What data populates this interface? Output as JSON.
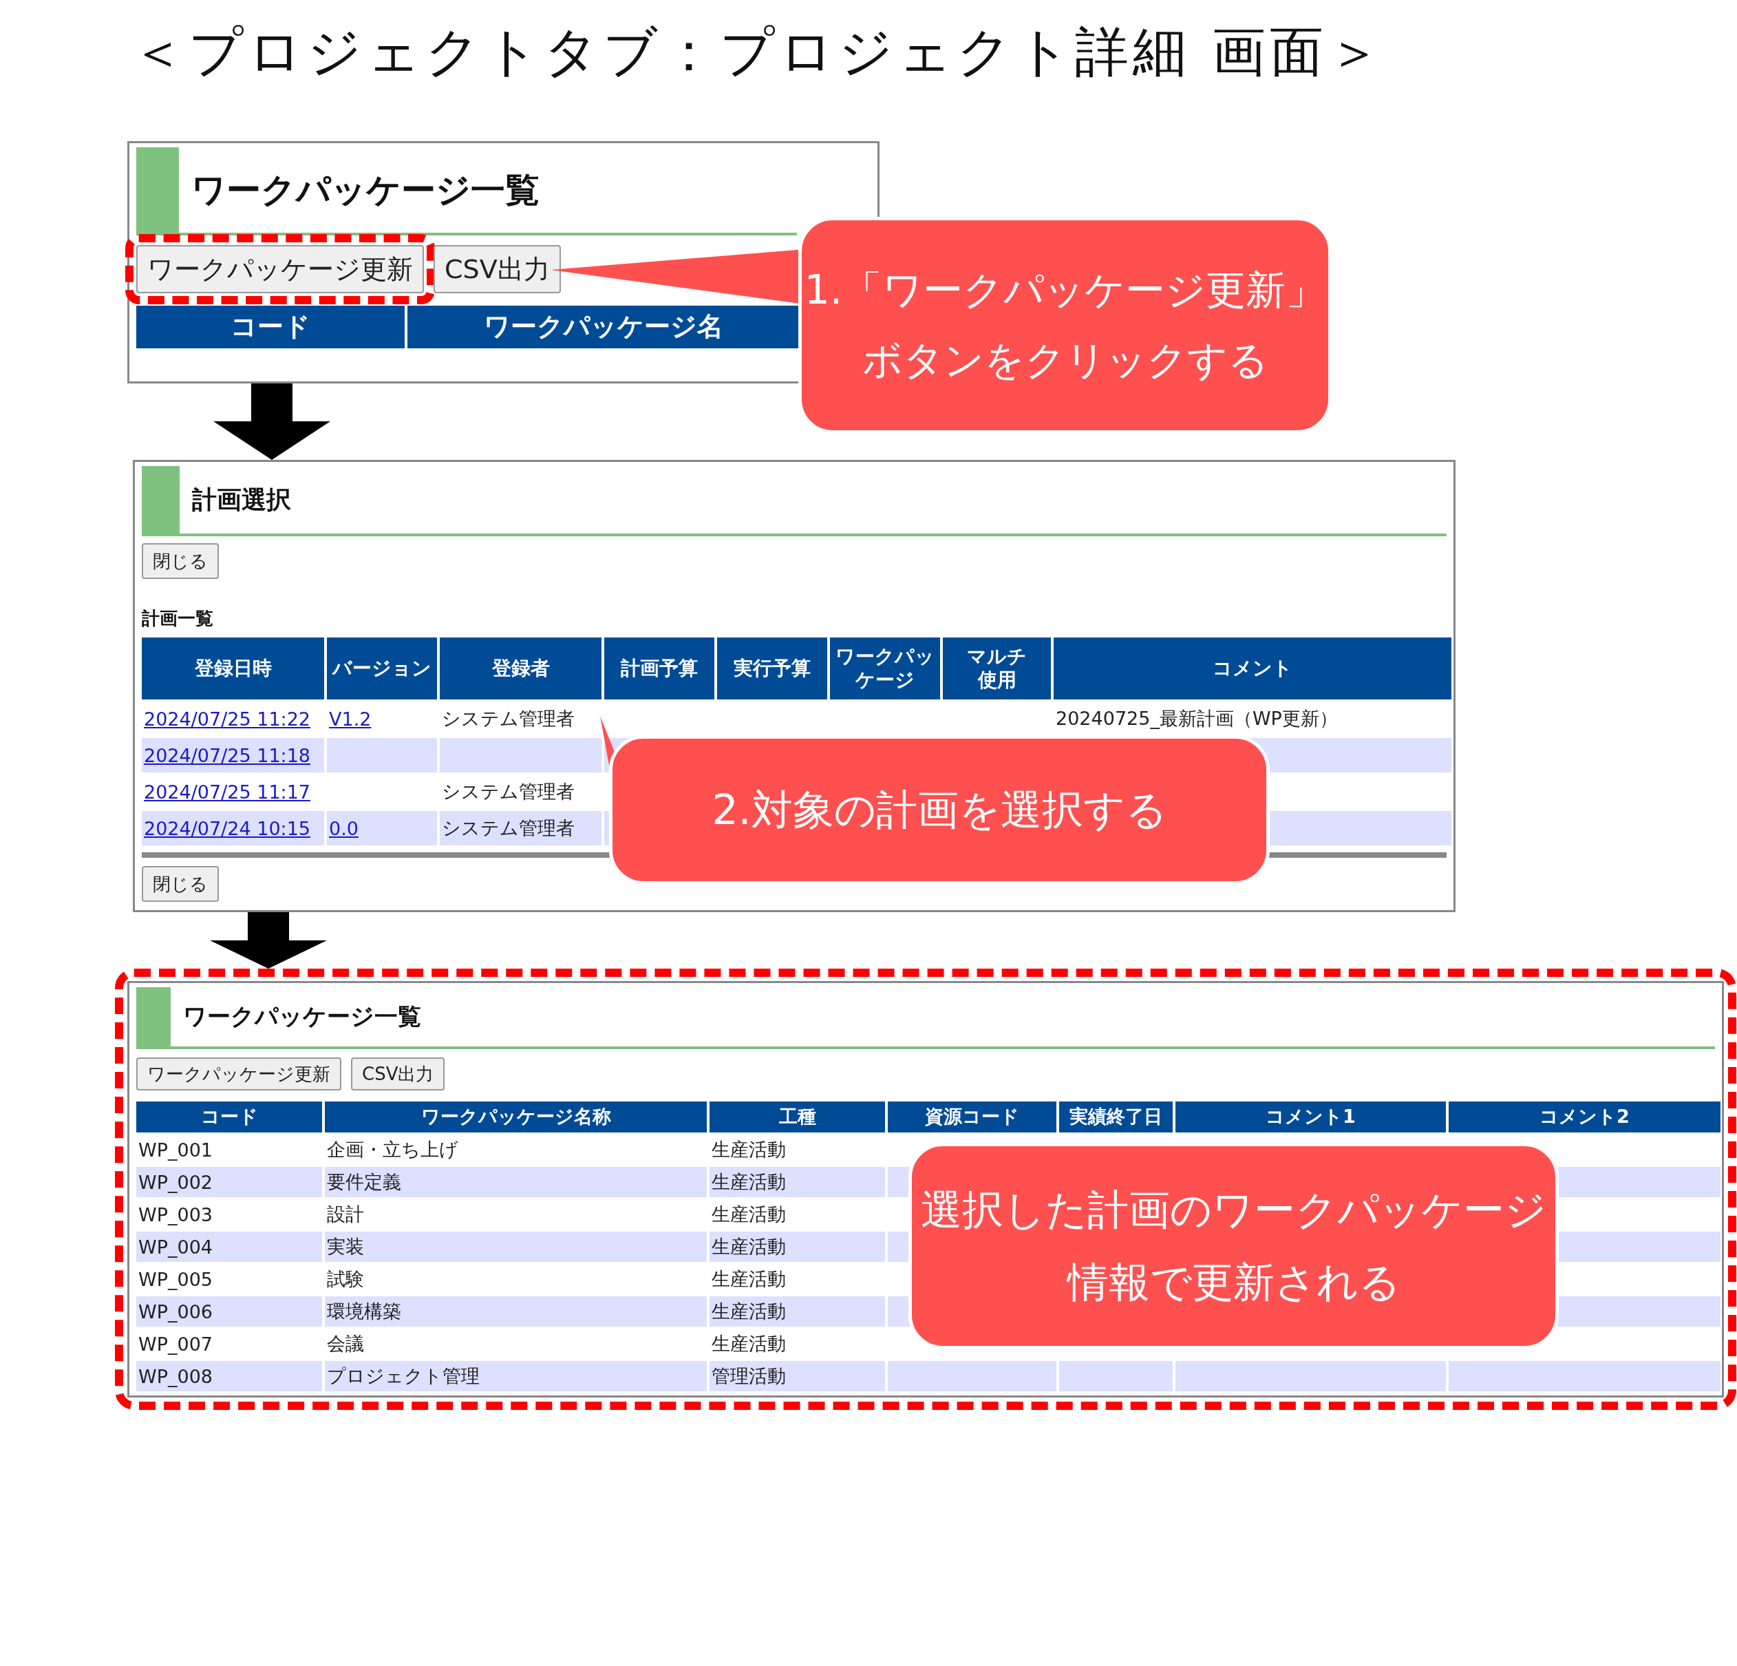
{
  "title": "＜プロジェクトタブ：プロジェクト詳細 画面＞",
  "wp_list_before": {
    "heading": "ワークパッケージ一覧",
    "buttons": [
      {
        "label": "ワークパッケージ更新",
        "highlighted": true
      },
      {
        "label": "CSV出力",
        "highlighted": false
      }
    ],
    "columns": [
      "コード",
      "ワークパッケージ名"
    ]
  },
  "plan_select": {
    "heading": "計画選択",
    "close_button": "閉じる",
    "list_title": "計画一覧",
    "columns": [
      [
        "登録日時"
      ],
      [
        "バージョン"
      ],
      [
        "登録者"
      ],
      [
        "計画予算"
      ],
      [
        "実行予算"
      ],
      [
        "ワークパッ",
        "ケージ"
      ],
      [
        "マルチ",
        "使用"
      ],
      [
        "コメント"
      ]
    ],
    "rows": [
      {
        "date": "2024/07/25 11:22",
        "version": "V1.2",
        "registrant": "システム管理者",
        "comment": "20240725_最新計画（WP更新）"
      },
      {
        "date": "2024/07/25 11:18"
      },
      {
        "date": "2024/07/25 11:17",
        "registrant": "システム管理者"
      },
      {
        "date": "2024/07/24 10:15",
        "version": "0.0",
        "registrant": "システム管理者"
      }
    ],
    "close_button_bottom": "閉じる"
  },
  "wp_list_after": {
    "heading": "ワークパッケージ一覧",
    "highlighted": true,
    "buttons": [
      {
        "label": "ワークパッケージ更新",
        "highlighted": false
      },
      {
        "label": "CSV出力",
        "highlighted": false
      }
    ],
    "columns": [
      "コード",
      "ワークパッケージ名称",
      "工種",
      "資源コード",
      "実績終了日",
      "コメント1",
      "コメント2"
    ],
    "rows": [
      {
        "code": "WP_001",
        "name": "企画・立ち上げ",
        "kind": "生産活動"
      },
      {
        "code": "WP_002",
        "name": "要件定義",
        "kind": "生産活動"
      },
      {
        "code": "WP_003",
        "name": "設計",
        "kind": "生産活動"
      },
      {
        "code": "WP_004",
        "name": "実装",
        "kind": "生産活動"
      },
      {
        "code": "WP_005",
        "name": "試験",
        "kind": "生産活動"
      },
      {
        "code": "WP_006",
        "name": "環境構築",
        "kind": "生産活動"
      },
      {
        "code": "WP_007",
        "name": "会議",
        "kind": "生産活動"
      },
      {
        "code": "WP_008",
        "name": "プロジェクト管理",
        "kind": "管理活動"
      }
    ]
  },
  "callouts": [
    {
      "lines": [
        "1.「ワークパッケージ更新」",
        "ボタンをクリックする"
      ]
    },
    {
      "lines": [
        "2.対象の計画を選択する"
      ]
    },
    {
      "lines": [
        "選択した計画のワークパッケージ",
        "情報で更新される"
      ]
    }
  ]
}
